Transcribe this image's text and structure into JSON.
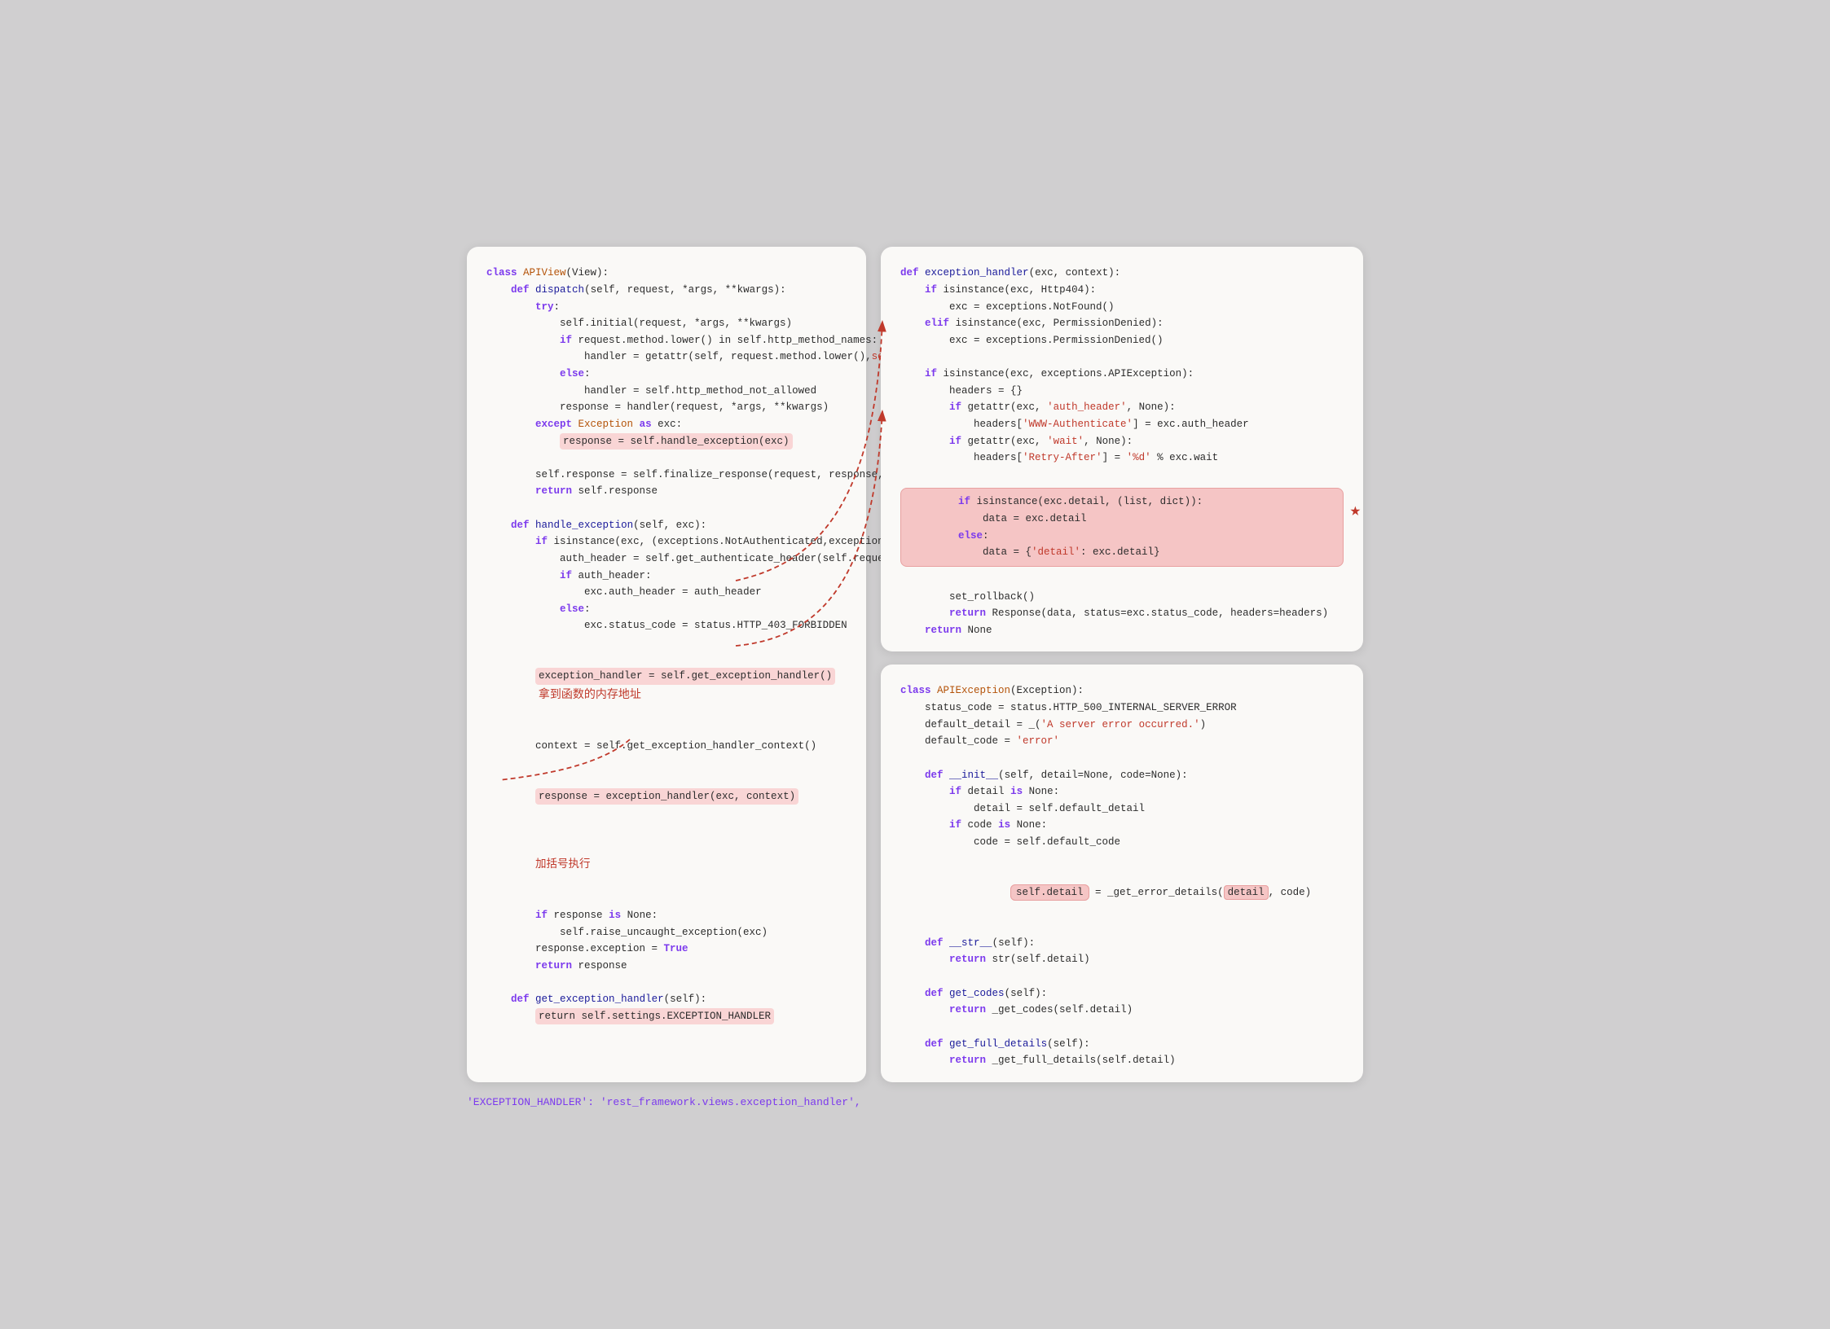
{
  "left_panel": {
    "lines": [
      {
        "indent": 0,
        "text": "class APIView(View):"
      },
      {
        "indent": 1,
        "text": "def dispatch(self, request, *args, **kwargs):"
      },
      {
        "indent": 2,
        "text": "try:"
      },
      {
        "indent": 3,
        "text": "self.initial(request, *args, **kwargs)"
      },
      {
        "indent": 3,
        "text": "if request.method.lower() in self.http_method_names:"
      },
      {
        "indent": 4,
        "text": "handler = getattr(self, request.method.lower(),self.http_method_not_allowed)"
      },
      {
        "indent": 3,
        "text": "else:"
      },
      {
        "indent": 4,
        "text": "handler = self.http_method_not_allowed"
      },
      {
        "indent": 3,
        "text": "response = handler(request, *args, **kwargs)"
      },
      {
        "indent": 2,
        "text": "except Exception as exc:"
      },
      {
        "indent": 3,
        "text": "response = self.handle_exception(exc)",
        "highlight": true
      },
      {
        "indent": 2,
        "text": ""
      },
      {
        "indent": 2,
        "text": "self.response = self.finalize_response(request, response, *args, **kwargs)"
      },
      {
        "indent": 2,
        "text": "return self.response"
      },
      {
        "indent": 0,
        "text": ""
      },
      {
        "indent": 1,
        "text": "def handle_exception(self, exc):"
      },
      {
        "indent": 2,
        "text": "if isinstance(exc, (exceptions.NotAuthenticated,exceptions.AuthenticationFailed)):"
      },
      {
        "indent": 3,
        "text": "auth_header = self.get_authenticate_header(self.request)"
      },
      {
        "indent": 3,
        "text": "if auth_header:"
      },
      {
        "indent": 4,
        "text": "exc.auth_header = auth_header"
      },
      {
        "indent": 3,
        "text": "else:"
      },
      {
        "indent": 4,
        "text": "exc.status_code = status.HTTP_403_FORBIDDEN"
      },
      {
        "indent": 2,
        "text": ""
      },
      {
        "indent": 2,
        "text": "exception_handler = self.get_exception_handler()",
        "highlight": true
      },
      {
        "indent": 0,
        "text": ""
      },
      {
        "indent": 2,
        "text": "context = self.get_exception_handler_context()"
      },
      {
        "indent": 0,
        "text": ""
      },
      {
        "indent": 2,
        "text": "response = exception_handler(exc, context)",
        "highlight": true
      },
      {
        "indent": 2,
        "text": ""
      },
      {
        "indent": 2,
        "text": "if response is None:"
      },
      {
        "indent": 3,
        "text": "self.raise_uncaught_exception(exc)"
      },
      {
        "indent": 2,
        "text": "response.exception = True"
      },
      {
        "indent": 2,
        "text": "return response"
      },
      {
        "indent": 0,
        "text": ""
      },
      {
        "indent": 1,
        "text": "def get_exception_handler(self):"
      },
      {
        "indent": 2,
        "text": "return self.settings.EXCEPTION_HANDLER",
        "highlight": true
      }
    ],
    "annotation1": "拿到函数的内存地址",
    "annotation2": "加括号执行",
    "bottom_text": "'EXCEPTION_HANDLER': 'rest_framework.views.exception_handler',"
  },
  "right_top_panel": {
    "title": "def exception_handler(exc, context):",
    "lines": [
      "    if isinstance(exc, Http404):",
      "        exc = exceptions.NotFound()",
      "    elif isinstance(exc, PermissionDenied):",
      "        exc = exceptions.PermissionDenied()",
      "",
      "    if isinstance(exc, exceptions.APIException):",
      "        headers = {}",
      "        if getattr(exc, 'auth_header', None):",
      "            headers['WWW-Authenticate'] = exc.auth_header",
      "        if getattr(exc, 'wait', None):",
      "            headers['Retry-After'] = '%d' % exc.wait",
      "",
      "        if isinstance(exc.detail, (list, dict)):",
      "            data = exc.detail",
      "        else:",
      "            data = {'detail': exc.detail}",
      "",
      "        set_rollback()",
      "        return Response(data, status=exc.status_code, headers=headers)",
      "    return None"
    ],
    "highlight_block_lines": [
      "        if isinstance(exc.detail, (list, dict)):",
      "            data = exc.detail",
      "        else:",
      "            data = {'detail': exc.detail}"
    ]
  },
  "right_bottom_panel": {
    "title": "class APIException(Exception):",
    "lines": [
      "    status_code = status.HTTP_500_INTERNAL_SERVER_ERROR",
      "    default_detail = _('A server error occurred.')",
      "    default_code = 'error'",
      "",
      "    def __init__(self, detail=None, code=None):",
      "        if detail is None:",
      "            detail = self.default_detail",
      "        if code is None:",
      "            code = self.default_code",
      "",
      "        self.detail = _get_error_details(detail, code)",
      "",
      "    def __str__(self):",
      "        return str(self.detail)",
      "",
      "    def get_codes(self):",
      "        return _get_codes(self.detail)",
      "",
      "    def get_full_details(self):",
      "        return _get_full_details(self.detail)"
    ]
  },
  "colors": {
    "background": "#d0cfd0",
    "panel_bg": "#faf9f7",
    "highlight_pink": "#f9d5d5",
    "highlight_block": "#f5c5c5",
    "border_pink": "#e8a0a0",
    "kw_purple": "#7c3aed",
    "fn_blue": "#1a1a9a",
    "str_red": "#c0392b",
    "arrow_red": "#c0392b"
  }
}
